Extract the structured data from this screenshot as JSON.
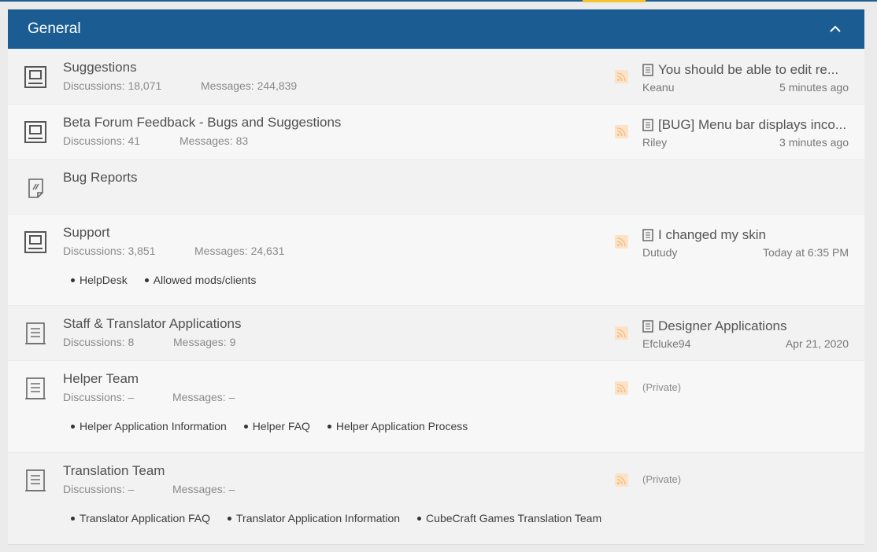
{
  "block": {
    "title": "General",
    "collapse_icon": "chevron-up-icon"
  },
  "forums": [
    {
      "title": "Suggestions",
      "icon": "forum-icon",
      "discussions": "Discussions: 18,071",
      "messages": "Messages: 244,839",
      "latest": {
        "title": "You should be able to edit re...",
        "user": "Keanu",
        "time": "5 minutes ago"
      }
    },
    {
      "title": "Beta Forum Feedback - Bugs and Suggestions",
      "icon": "forum-icon",
      "discussions": "Discussions: 41",
      "messages": "Messages: 83",
      "latest": {
        "title": "[BUG] Menu bar displays inco...",
        "user": "Riley",
        "time": "3 minutes ago"
      }
    },
    {
      "title": "Bug Reports",
      "icon": "link-forum-icon"
    },
    {
      "title": "Support",
      "icon": "forum-icon",
      "discussions": "Discussions: 3,851",
      "messages": "Messages: 24,631",
      "subforums": [
        "HelpDesk",
        "Allowed mods/clients"
      ],
      "latest": {
        "title": "I changed my skin",
        "user": "Dutudy",
        "time": "Today at 6:35 PM"
      }
    },
    {
      "title": "Staff & Translator Applications",
      "icon": "category-icon",
      "discussions": "Discussions: 8",
      "messages": "Messages: 9",
      "latest": {
        "title": "Designer Applications",
        "user": "Efcluke94",
        "time": "Apr 21, 2020"
      }
    },
    {
      "title": "Helper Team",
      "icon": "category-icon",
      "discussions": "Discussions: –",
      "messages": "Messages: –",
      "subforums": [
        "Helper Application Information",
        "Helper FAQ",
        "Helper Application Process"
      ],
      "private": "(Private)"
    },
    {
      "title": "Translation Team",
      "icon": "category-icon",
      "discussions": "Discussions: –",
      "messages": "Messages: –",
      "subforums": [
        "Translator Application FAQ",
        "Translator Application Information",
        "CubeCraft Games Translation Team"
      ],
      "private": "(Private)"
    }
  ],
  "colors": {
    "header": "#1b5d92",
    "accent": "#f4c430",
    "rss": "#f5c28a"
  }
}
